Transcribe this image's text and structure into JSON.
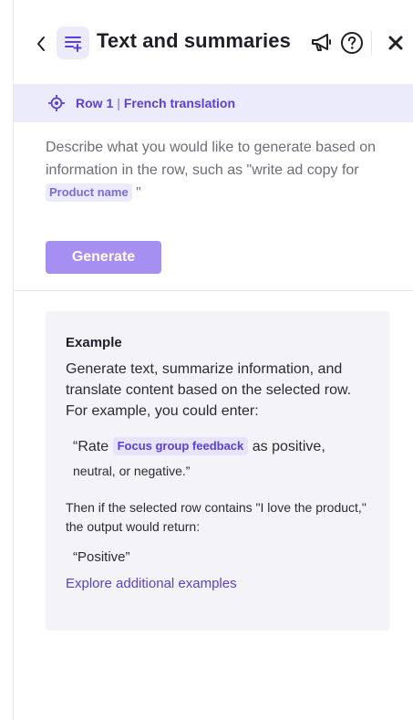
{
  "header": {
    "title": "Text and summaries",
    "back_icon": "chevron-left-icon",
    "title_icon": "text-lines-sparkle-icon",
    "announce_icon": "megaphone-icon",
    "help_icon": "help-circle-icon",
    "close_icon": "close-icon"
  },
  "context": {
    "row_label": "Row 1",
    "separator": "|",
    "column_label": "French translation"
  },
  "prompt": {
    "text_before": "Describe what you would like to generate based on information in the row, such as \"write ad copy for ",
    "chip": "Product name",
    "text_after": " \""
  },
  "generate_label": "Generate",
  "example": {
    "heading": "Example",
    "body": "Generate text, summarize information, and translate content based on the selected row. For example, you could enter:",
    "quote_before": "“Rate ",
    "quote_chip": "Focus group feedback",
    "quote_after": " as positive,",
    "quote_line2": "neutral, or negative.”",
    "result": "Then if the selected row contains \"I love the product,\" the output would return:",
    "output": "“Positive”",
    "link": "Explore additional examples"
  },
  "colors": {
    "accent": "#5b3fd6",
    "context_bg": "#ecebfb",
    "button_disabled": "#a58ff0",
    "card_bg": "#f4f4f8"
  }
}
